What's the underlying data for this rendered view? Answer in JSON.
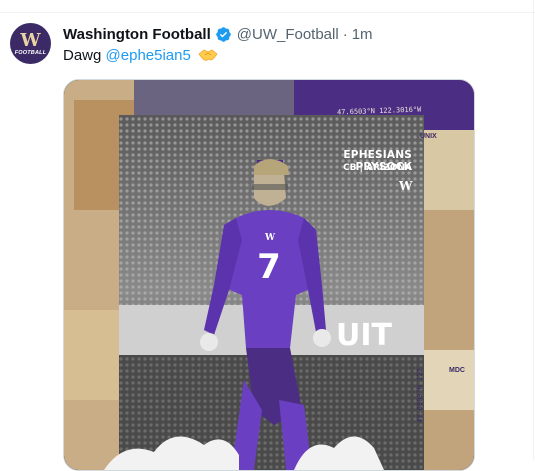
{
  "tweet": {
    "author_name": "Washington Football",
    "handle": "@UW_Football",
    "separator": "·",
    "time": "1m",
    "text_prefix": "Dawg ",
    "mention": "@ephe5ian5",
    "emoji": "handshake-emoji",
    "avatar_text": "FOOTBALL",
    "avatar_letter": "W",
    "verified_color": "#1d9bf0"
  },
  "graphic": {
    "player_name": "EPHESIANS PRYSOCK",
    "player_position": "CB | ARIZONA",
    "jersey_number": "7",
    "coords_top": "47.6503°N 122.3016°W",
    "coords_bottom": "47.6503°N 122",
    "stadium_sign": "UIT",
    "tag_text": "MDC",
    "unix_text": "UNIX"
  },
  "colors": {
    "uw_purple": "#4b2e83",
    "uw_gold": "#b7a57a",
    "link_blue": "#1d9bf0"
  }
}
